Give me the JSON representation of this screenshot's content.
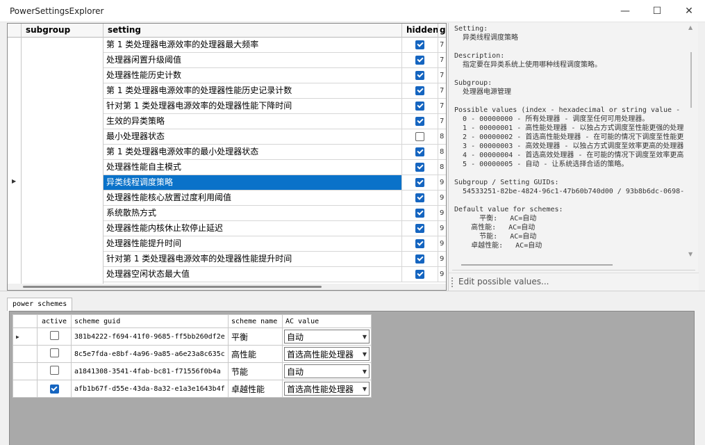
{
  "window": {
    "title": "PowerSettingsExplorer",
    "minimize": "—",
    "maximize": "☐",
    "close": "✕"
  },
  "grid": {
    "headers": {
      "subgroup": "subgroup",
      "setting": "setting",
      "hidden": "hidden",
      "extra": "g"
    },
    "rows": [
      {
        "setting": "第 1 类处理器电源效率的处理器最大频率",
        "hidden": true,
        "num": "7"
      },
      {
        "setting": "处理器闲置升级阈值",
        "hidden": true,
        "num": "7"
      },
      {
        "setting": "处理器性能历史计数",
        "hidden": true,
        "num": "7"
      },
      {
        "setting": "第 1 类处理器电源效率的处理器性能历史记录计数",
        "hidden": true,
        "num": "7"
      },
      {
        "setting": "针对第 1 类处理器电源效率的处理器性能下降时间",
        "hidden": true,
        "num": "7"
      },
      {
        "setting": "生效的异类策略",
        "hidden": true,
        "num": "7"
      },
      {
        "setting": "最小处理器状态",
        "hidden": false,
        "num": "8"
      },
      {
        "setting": "第 1 类处理器电源效率的最小处理器状态",
        "hidden": true,
        "num": "8"
      },
      {
        "setting": "处理器性能自主模式",
        "hidden": true,
        "num": "8"
      },
      {
        "setting": "异类线程调度策略",
        "hidden": true,
        "num": "9",
        "selected": true
      },
      {
        "setting": "处理器性能核心放置过度利用阈值",
        "hidden": true,
        "num": "9"
      },
      {
        "setting": "系统散热方式",
        "hidden": true,
        "num": "9"
      },
      {
        "setting": "处理器性能内核休止软停止延迟",
        "hidden": true,
        "num": "9"
      },
      {
        "setting": "处理器性能提升时间",
        "hidden": true,
        "num": "9"
      },
      {
        "setting": "针对第 1 类处理器电源效率的处理器性能提升时间",
        "hidden": true,
        "num": "9"
      },
      {
        "setting": "处理器空闲状态最大值",
        "hidden": true,
        "num": "9"
      }
    ]
  },
  "detail": {
    "text": "Setting:\n  异类线程调度策略\n\nDescription:\n  指定要在异类系统上使用哪种线程调度策略。\n\nSubgroup:\n  处理器电源管理\n\nPossible values (index - hexadecimal or string value - f\n  0 - 00000000 - 所有处理器 - 调度至任何可用处理器。\n  1 - 00000001 - 高性能处理器 - 以独占方式调度至性能更强的处理器\n  2 - 00000002 - 首选高性能处理器 - 在可能的情况下调度至性能更强\n  3 - 00000003 - 高效处理器 - 以独占方式调度至效率更高的处理器。\n  4 - 00000004 - 首选高效处理器 - 在可能的情况下调度至效率更高的\n  5 - 00000005 - 自动 - 让系统选择合适的策略。\n\nSubgroup / Setting GUIDs:\n  54533251-82be-4824-96c1-47b60b740d00 / 93b8b6dc-0698-4\n\nDefault value for schemes:\n      平衡:   AC=自动\n    高性能:   AC=自动\n      节能:   AC=自动\n    卓越性能:   AC=自动",
    "edit_placeholder": "Edit possible values..."
  },
  "schemes": {
    "tab": "power schemes",
    "headers": {
      "active": "active",
      "guid": "scheme guid",
      "name": "scheme name",
      "ac": "AC value"
    },
    "rows": [
      {
        "active": false,
        "guid": "381b4222-f694-41f0-9685-ff5bb260df2e",
        "name": "平衡",
        "ac": "自动",
        "current": true
      },
      {
        "active": false,
        "guid": "8c5e7fda-e8bf-4a96-9a85-a6e23a8c635c",
        "name": "高性能",
        "ac": "首选高性能处理器"
      },
      {
        "active": false,
        "guid": "a1841308-3541-4fab-bc81-f71556f0b4a",
        "name": "节能",
        "ac": "自动"
      },
      {
        "active": true,
        "guid": "afb1b67f-d55e-43da-8a32-e1a3e1643b4f",
        "name": "卓越性能",
        "ac": "首选高性能处理器"
      }
    ]
  }
}
